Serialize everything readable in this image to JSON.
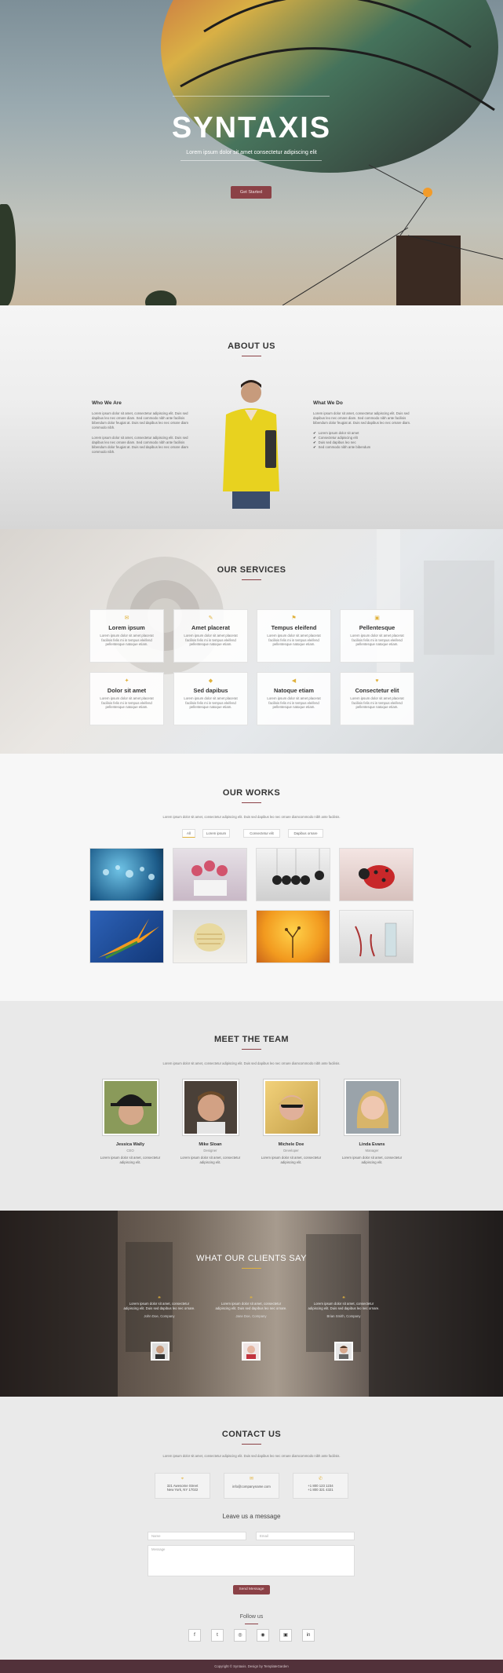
{
  "hero": {
    "title": "SYNTAXIS",
    "tagline": "Lorem ipsum dolor sit amet consectetur adipiscing elit",
    "cta": "Get Started"
  },
  "about": {
    "heading": "ABOUT US",
    "left_title": "Who We Are",
    "left_p1": "Lorem ipsum dolor sit amet, consectetur adipiscing elit. Duis sed dapibus leo nec ornare diam. Sed commodo nibh ante facilisis bibendum dolor feugiat at. Duis sed dapibus leo nec ornare diam commodo nibh.",
    "left_p2": "Lorem ipsum dolor sit amet, consectetur adipiscing elit. Duis sed dapibus leo nec ornare diam. Sed commodo nibh ante facilisis bibendum dolor feugiat at. Duis sed dapibus leo nec ornare diam commodo nibh.",
    "right_title": "What We Do",
    "right_p": "Lorem ipsum dolor sit amet, consectetur adipiscing elit. Duis sed dapibus leo nec ornare diam. Sed commodo nibh ante facilisis bibendum dolor feugiat at. Duis sed dapibus leo nec ornare diam.",
    "list": [
      "Lorem ipsum dolor sit amet",
      "Consectetur adipiscing elit",
      "Duis sed dapibus leo nec",
      "Sed commodo nibh ante bibendum"
    ]
  },
  "services": {
    "heading": "OUR SERVICES",
    "desc": "Lorem ipsum dolor sit amet placerat facilisis felis mi in tempus eleifend pellentesque natoque etiam.",
    "items": [
      {
        "title": "Lorem ipsum",
        "icon": "comment-icon",
        "glyph": "✉"
      },
      {
        "title": "Amet placerat",
        "icon": "pencil-icon",
        "glyph": "✎"
      },
      {
        "title": "Tempus eleifend",
        "icon": "flag-icon",
        "glyph": "⚑"
      },
      {
        "title": "Pellentesque",
        "icon": "briefcase-icon",
        "glyph": "▣"
      },
      {
        "title": "Dolor sit amet",
        "icon": "lightbulb-icon",
        "glyph": "✦"
      },
      {
        "title": "Sed dapibus",
        "icon": "diamond-icon",
        "glyph": "◆"
      },
      {
        "title": "Natoque etiam",
        "icon": "bullhorn-icon",
        "glyph": "◀"
      },
      {
        "title": "Consectetur elit",
        "icon": "heart-icon",
        "glyph": "♥"
      }
    ]
  },
  "works": {
    "heading": "OUR WORKS",
    "lead": "Lorem ipsum dolor sit amet, consectetur adipiscing elit. Duis sed dapibus leo nec ornare diamcommodo nibh ante facilisis.",
    "filters": [
      "All",
      "Lorem ipsum",
      "Consectetur elit",
      "Dapibus ornare"
    ]
  },
  "team": {
    "heading": "MEET THE TEAM",
    "lead": "Lorem ipsum dolor sit amet, consectetur adipiscing elit. Duis sed dapibus leo nec ornare diamcommodo nibh ante facilisis.",
    "members": [
      {
        "name": "Jessica Wally",
        "role": "CEO",
        "bio": "Lorem ipsum dolor sit amet, consectetur adipiscing elit."
      },
      {
        "name": "Mike Sloan",
        "role": "Designer",
        "bio": "Lorem ipsum dolor sit amet, consectetur adipiscing elit."
      },
      {
        "name": "Michele Doe",
        "role": "Developer",
        "bio": "Lorem ipsum dolor sit amet, consectetur adipiscing elit."
      },
      {
        "name": "Linda Evans",
        "role": "Manager",
        "bio": "Lorem ipsum dolor sit amet, consectetur adipiscing elit."
      }
    ]
  },
  "clients": {
    "heading": "WHAT OUR CLIENTS SAY",
    "quotes": [
      {
        "text": "Lorem ipsum dolor sit amet, consectetur adipiscing elit. Duis sed dapibus leo nec ornare.",
        "author": "John Doe, Company"
      },
      {
        "text": "Lorem ipsum dolor sit amet, consectetur adipiscing elit. Duis sed dapibus leo nec ornare.",
        "author": "Jane Doe, Company"
      },
      {
        "text": "Lorem ipsum dolor sit amet, consectetur adipiscing elit. Duis sed dapibus leo nec ornare.",
        "author": "Brian Smith, Company"
      }
    ]
  },
  "contact": {
    "heading": "CONTACT US",
    "lead": "Lorem ipsum dolor sit amet, consectetur adipiscing elit. Duis sed dapibus leo nec ornare diamcommodo nibh ante facilisis.",
    "address1": "321 Awesome Street",
    "address2": "New York, NY 17022",
    "email": "info@companyname.com",
    "phone1": "+1 800 123 1234",
    "phone2": "+1 800 321 4321",
    "form_title": "Leave us a message",
    "name_ph": "Name",
    "email_ph": "Email",
    "message_ph": "Message",
    "send": "Send Message",
    "follow": "Follow us",
    "social": [
      {
        "icon": "facebook-icon",
        "glyph": "f"
      },
      {
        "icon": "twitter-icon",
        "glyph": "t"
      },
      {
        "icon": "dribbble-icon",
        "glyph": "◎"
      },
      {
        "icon": "github-icon",
        "glyph": "◉"
      },
      {
        "icon": "instagram-icon",
        "glyph": "▣"
      },
      {
        "icon": "linkedin-icon",
        "glyph": "in"
      }
    ]
  },
  "footer": {
    "text": "Copyright © Syntaxis. Design by TemplateGarden"
  },
  "colors": {
    "accent": "#e0b23d",
    "brand": "#8b4146",
    "footer": "#52313a"
  }
}
